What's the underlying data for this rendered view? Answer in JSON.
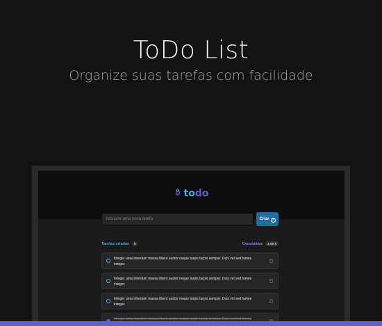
{
  "hero": {
    "title": "ToDo List",
    "subtitle": "Organize suas tarefas com facilidade"
  },
  "app": {
    "logo_part1": "to",
    "logo_part2": "do",
    "input_placeholder": "Adicione uma nova tarefa",
    "create_label": "Criar",
    "created_label": "Tarefas criadas",
    "created_count": "5",
    "done_label": "Concluídas",
    "done_count": "2 de 5",
    "tasks": [
      {
        "text": "Integer urna interdum massa libero auctor neque turpis turpis semper. Duis vel sed fames integer.",
        "done": false
      },
      {
        "text": "Integer urna interdum massa libero auctor neque turpis turpis semper. Duis vel sed fames integer.",
        "done": false
      },
      {
        "text": "Integer urna interdum massa libero auctor neque turpis turpis semper. Duis vel sed fames integer.",
        "done": false
      },
      {
        "text": "Integer urna interdum massa libero auctor neque turpis turpis semper. Duis vel sed fames integer.",
        "done": true
      }
    ]
  },
  "colors": {
    "blue": "#4ea8de",
    "purple": "#5e60ce",
    "purple_light": "#8284fa",
    "button": "#1e6f9f"
  }
}
